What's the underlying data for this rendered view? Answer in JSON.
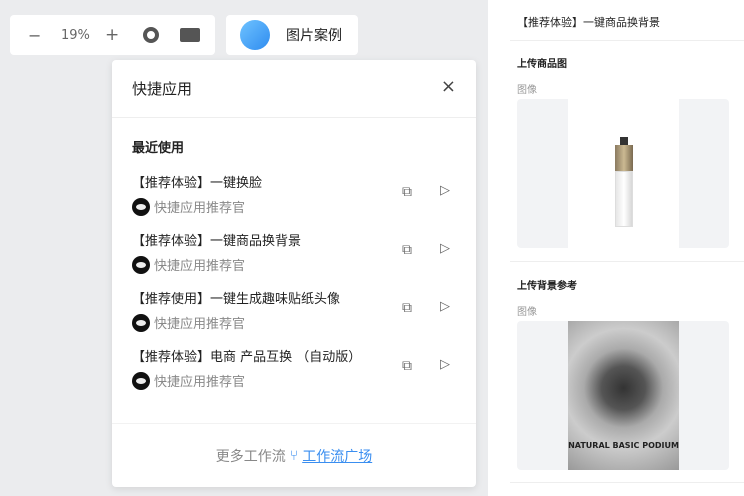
{
  "toolbar": {
    "zoom_out": "−",
    "zoom": "19%",
    "zoom_in": "+",
    "case_label": "图片案例"
  },
  "popup": {
    "title": "快捷应用",
    "close": "×",
    "section": "最近使用",
    "items": [
      {
        "name": "【推荐体验】一键换脸",
        "author": "快捷应用推荐官"
      },
      {
        "name": "【推荐体验】一键商品换背景",
        "author": "快捷应用推荐官"
      },
      {
        "name": "【推荐使用】一键生成趣味贴纸头像",
        "author": "快捷应用推荐官"
      },
      {
        "name": "【推荐体验】电商 产品互换 （自动版）",
        "author": "快捷应用推荐官"
      }
    ],
    "more": "更多工作流",
    "link": "工作流广场"
  },
  "panel": {
    "title": "【推荐体验】一键商品换背景",
    "upload1": "上传商品图",
    "image1": "图像",
    "upload2": "上传背景参考",
    "image2": "图像",
    "poster_text": "NATURAL BASIC PODIUM"
  }
}
